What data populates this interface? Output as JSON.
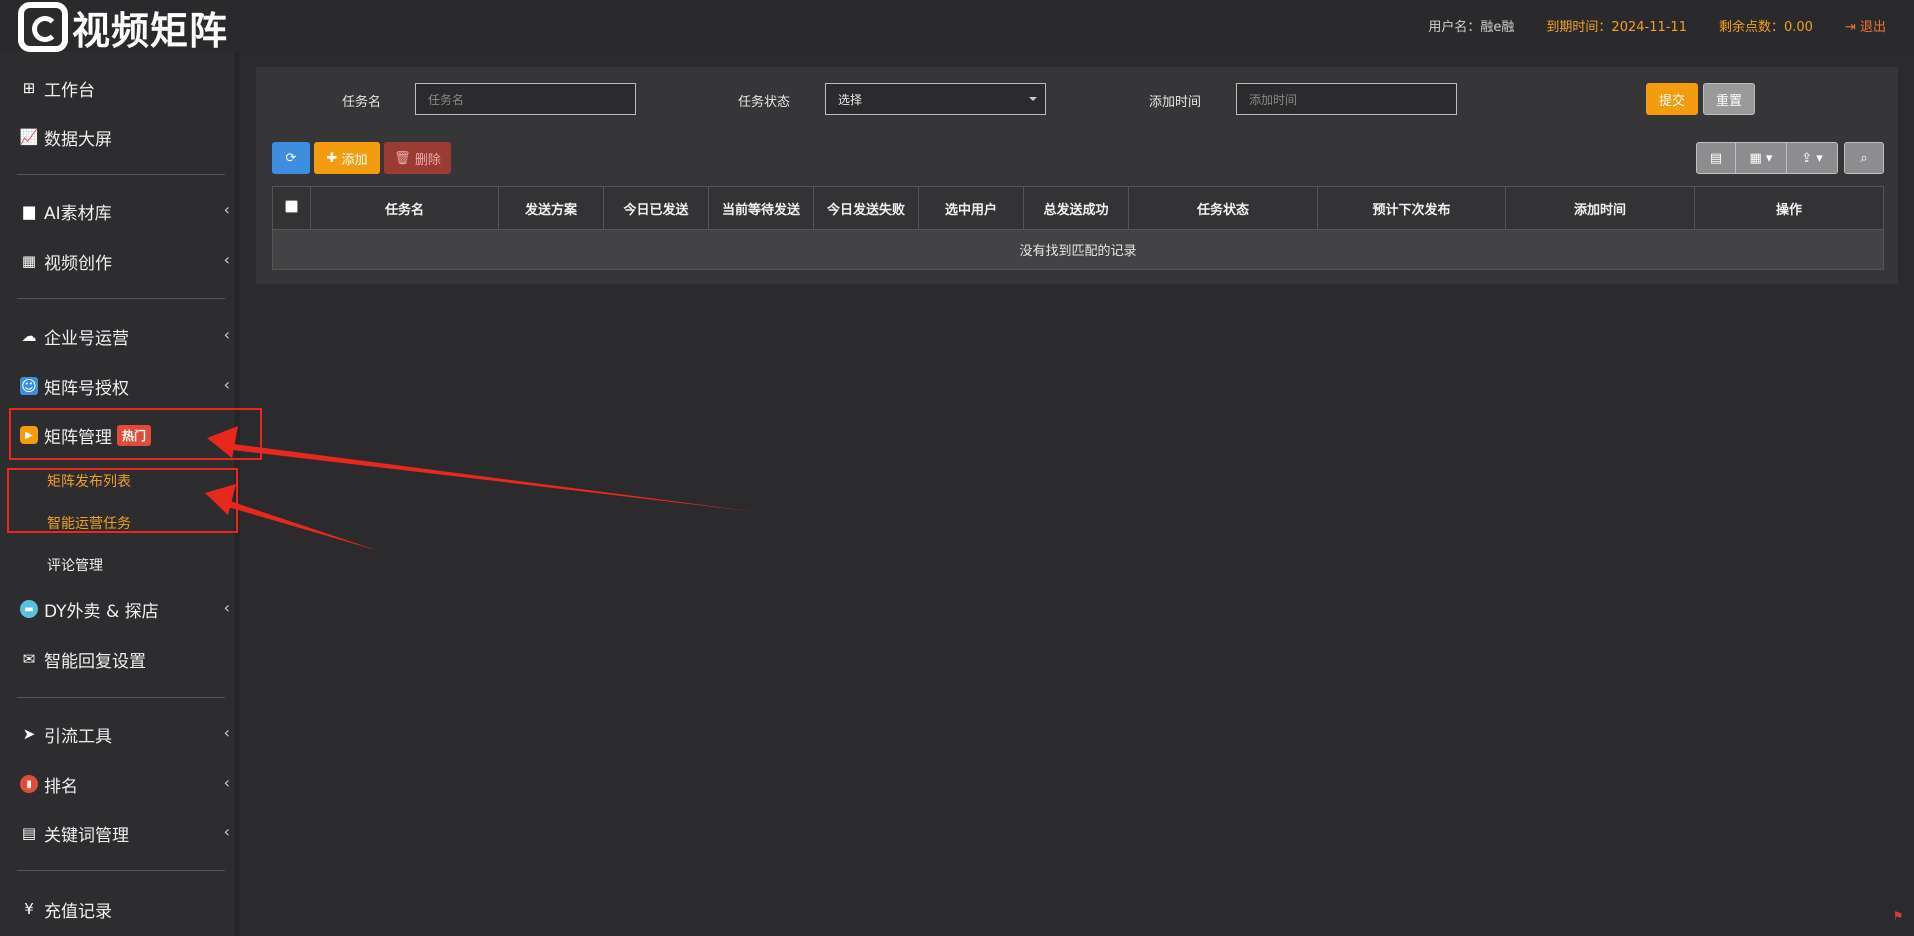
{
  "header": {
    "logo_text": "视频矩阵",
    "user_label": "用户名：融e融",
    "expire_label": "到期时间：2024-11-11",
    "points_label": "剩余点数：0.00",
    "logout_label": "退出"
  },
  "sidebar": {
    "items": [
      {
        "label": "工作台",
        "icon": "windows-icon"
      },
      {
        "label": "数据大屏",
        "icon": "chart-line-icon"
      },
      {
        "label": "AI素材库",
        "icon": "folder-icon"
      },
      {
        "label": "视频创作",
        "icon": "film-icon"
      },
      {
        "label": "企业号运营",
        "icon": "cloud-icon"
      },
      {
        "label": "矩阵号授权",
        "icon": "contact-icon"
      },
      {
        "label": "矩阵管理",
        "icon": "play-icon",
        "badge": "热门"
      },
      {
        "label": "DY外卖 & 探店",
        "icon": "chat-icon"
      },
      {
        "label": "智能回复设置",
        "icon": "envelope-icon"
      },
      {
        "label": "引流工具",
        "icon": "send-icon"
      },
      {
        "label": "排名",
        "icon": "bar-chart-icon"
      },
      {
        "label": "关键词管理",
        "icon": "file-icon"
      },
      {
        "label": "充值记录",
        "icon": "yen-icon"
      }
    ],
    "sub_items": [
      {
        "label": "矩阵发布列表"
      },
      {
        "label": "智能运营任务"
      },
      {
        "label": "评论管理"
      }
    ]
  },
  "filters": {
    "task_name_label": "任务名",
    "task_name_placeholder": "任务名",
    "status_label": "任务状态",
    "status_value": "选择",
    "add_time_label": "添加时间",
    "add_time_placeholder": "添加时间",
    "submit_label": "提交",
    "reset_label": "重置"
  },
  "toolbar": {
    "add_label": "添加",
    "delete_label": "删除"
  },
  "table": {
    "columns": [
      "任务名",
      "发送方案",
      "今日已发送",
      "当前等待发送",
      "今日发送失败",
      "选中用户",
      "总发送成功",
      "任务状态",
      "预计下次发布",
      "添加时间",
      "操作"
    ],
    "empty_text": "没有找到匹配的记录"
  },
  "colors": {
    "accent_orange": "#f39c12",
    "refresh_blue": "#3e8ee0",
    "delete_red": "#9a3c34",
    "annotation_red": "#e8271e"
  }
}
